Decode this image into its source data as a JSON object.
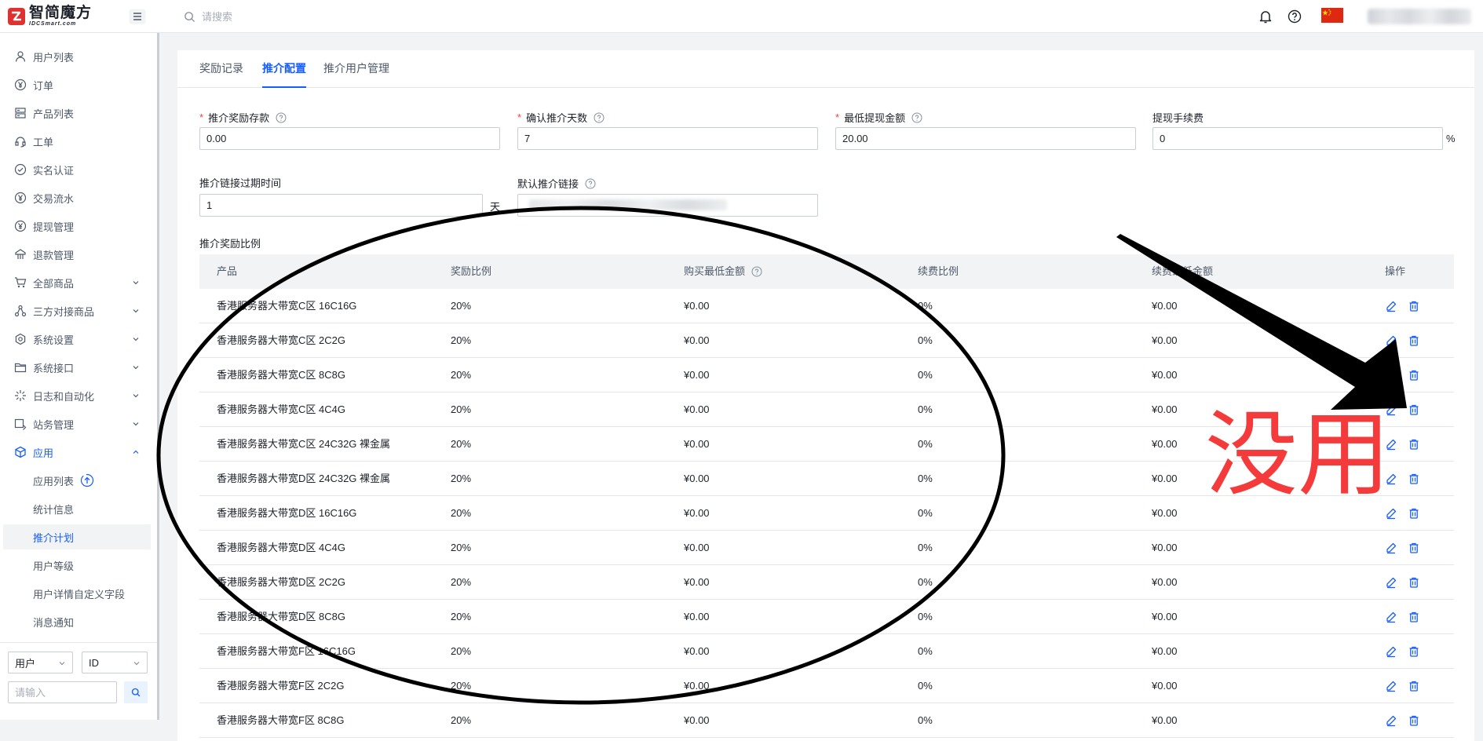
{
  "header": {
    "logo_title": "智简魔方",
    "logo_sub": "IDCSmart.com",
    "search_placeholder": "请搜索"
  },
  "sidebar": {
    "items": [
      {
        "label": "用户列表",
        "icon": "user-icon"
      },
      {
        "label": "订单",
        "icon": "yen-circle-icon"
      },
      {
        "label": "产品列表",
        "icon": "server-icon"
      },
      {
        "label": "工单",
        "icon": "headset-icon"
      },
      {
        "label": "实名认证",
        "icon": "check-circle-icon"
      },
      {
        "label": "交易流水",
        "icon": "yen-circle-icon"
      },
      {
        "label": "提现管理",
        "icon": "yen-circle-icon"
      },
      {
        "label": "退款管理",
        "icon": "refund-icon"
      },
      {
        "label": "全部商品",
        "icon": "cart-icon"
      },
      {
        "label": "三方对接商品",
        "icon": "network-icon"
      },
      {
        "label": "系统设置",
        "icon": "settings-icon"
      },
      {
        "label": "系统接口",
        "icon": "folder-icon"
      },
      {
        "label": "日志和自动化",
        "icon": "sparkle-icon"
      },
      {
        "label": "站务管理",
        "icon": "site-icon"
      },
      {
        "label": "应用",
        "icon": "cube-icon"
      }
    ],
    "sub_items": [
      "应用列表",
      "统计信息",
      "推介计划",
      "用户等级",
      "用户详情自定义字段",
      "消息通知"
    ],
    "active_sub": "推介计划",
    "filter_type": "用户",
    "filter_field": "ID",
    "filter_placeholder": "请输入"
  },
  "tabs": [
    "奖励记录",
    "推介配置",
    "推介用户管理"
  ],
  "active_tab": "推介配置",
  "form": {
    "reward_deposit_label": "推介奖励存款",
    "reward_deposit_value": "0.00",
    "confirm_days_label": "确认推介天数",
    "confirm_days_value": "7",
    "min_withdraw_label": "最低提现金额",
    "min_withdraw_value": "20.00",
    "withdraw_fee_label": "提现手续费",
    "withdraw_fee_value": "0",
    "withdraw_fee_unit": "%",
    "link_expire_label": "推介链接过期时间",
    "link_expire_value": "1",
    "link_expire_unit": "天",
    "default_link_label": "默认推介链接"
  },
  "table": {
    "section_label": "推介奖励比例",
    "headers": [
      "产品",
      "奖励比例",
      "购买最低金额",
      "续费比例",
      "续费最低金额",
      "操作"
    ],
    "rows": [
      [
        "香港服务器大带宽C区 16C16G",
        "20%",
        "¥0.00",
        "0%",
        "¥0.00"
      ],
      [
        "香港服务器大带宽C区 2C2G",
        "20%",
        "¥0.00",
        "0%",
        "¥0.00"
      ],
      [
        "香港服务器大带宽C区 8C8G",
        "20%",
        "¥0.00",
        "0%",
        "¥0.00"
      ],
      [
        "香港服务器大带宽C区 4C4G",
        "20%",
        "¥0.00",
        "0%",
        "¥0.00"
      ],
      [
        "香港服务器大带宽C区 24C32G 裸金属",
        "20%",
        "¥0.00",
        "0%",
        "¥0.00"
      ],
      [
        "香港服务器大带宽D区 24C32G 裸金属",
        "20%",
        "¥0.00",
        "0%",
        "¥0.00"
      ],
      [
        "香港服务器大带宽D区 16C16G",
        "20%",
        "¥0.00",
        "0%",
        "¥0.00"
      ],
      [
        "香港服务器大带宽D区 4C4G",
        "20%",
        "¥0.00",
        "0%",
        "¥0.00"
      ],
      [
        "香港服务器大带宽D区 2C2G",
        "20%",
        "¥0.00",
        "0%",
        "¥0.00"
      ],
      [
        "香港服务器大带宽D区 8C8G",
        "20%",
        "¥0.00",
        "0%",
        "¥0.00"
      ],
      [
        "香港服务器大带宽F区 16C16G",
        "20%",
        "¥0.00",
        "0%",
        "¥0.00"
      ],
      [
        "香港服务器大带宽F区 2C2G",
        "20%",
        "¥0.00",
        "0%",
        "¥0.00"
      ],
      [
        "香港服务器大带宽F区 8C8G",
        "20%",
        "¥0.00",
        "0%",
        "¥0.00"
      ]
    ]
  },
  "annotation": {
    "text": "没用",
    "color": "#f43a3a"
  },
  "colors": {
    "accent": "#165dff",
    "required": "#f53f3f",
    "flag": "#de2910"
  }
}
